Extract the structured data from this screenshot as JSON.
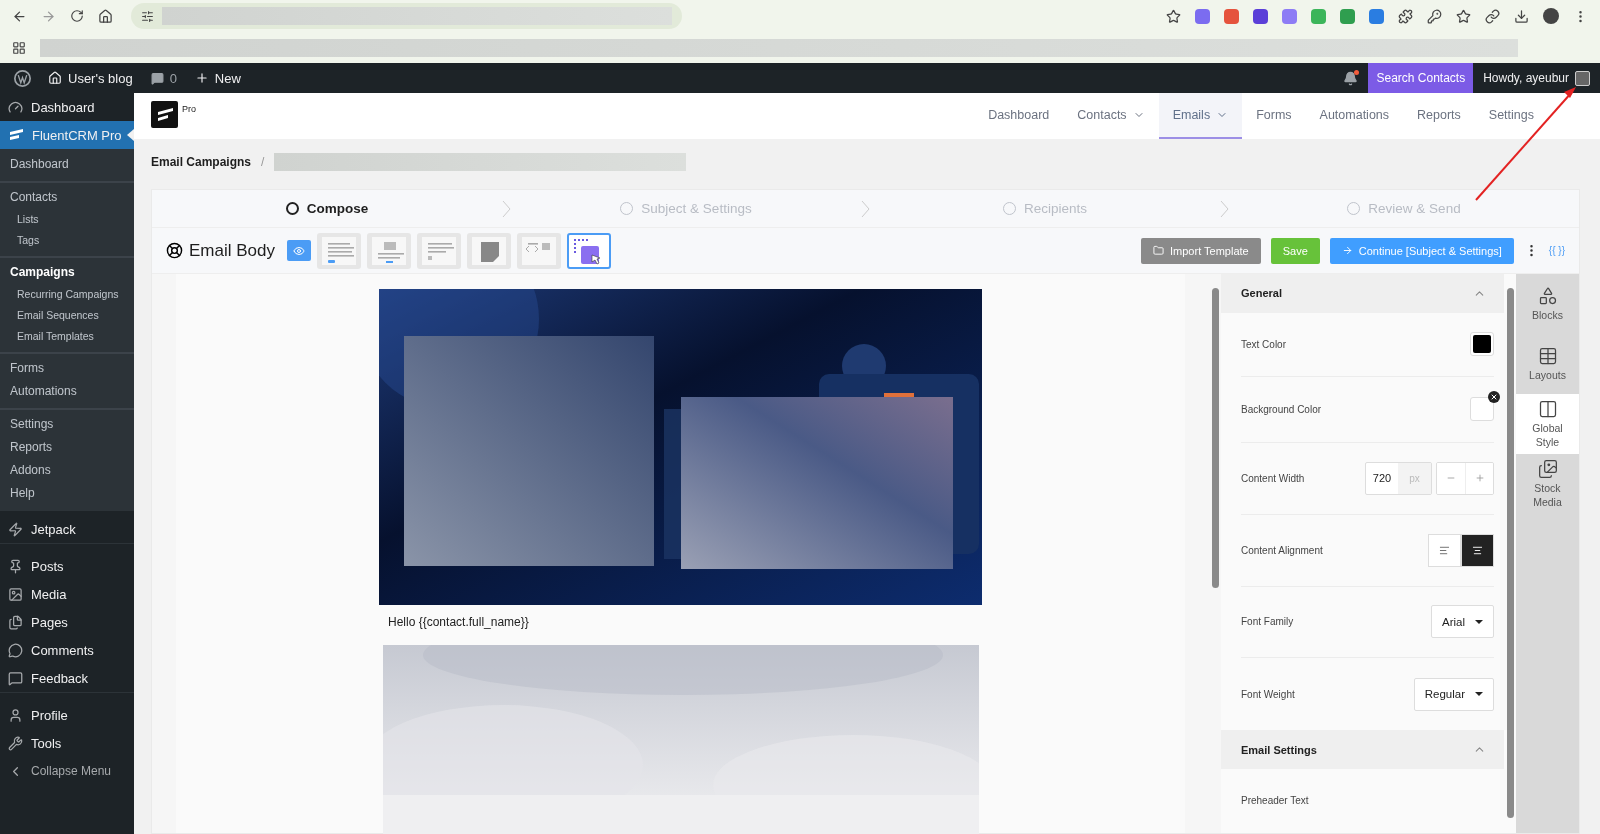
{
  "admin_bar": {
    "site": "User's blog",
    "comments": "0",
    "new": "New",
    "search_contacts": "Search Contacts",
    "greeting": "Howdy, ayeubur"
  },
  "sidebar": {
    "items": [
      {
        "label": "Dashboard",
        "kind": "menu",
        "selected": false
      },
      {
        "label": "FluentCRM Pro",
        "kind": "menu",
        "selected": true,
        "children": [
          {
            "label": "Dashboard",
            "selected": false
          },
          {
            "label": "Contacts",
            "selected": false,
            "group_start": true,
            "children": [
              {
                "label": "Lists",
                "selected": false
              },
              {
                "label": "Tags",
                "selected": false
              }
            ]
          },
          {
            "label": "Campaigns",
            "selected": true,
            "group_start": true,
            "children": [
              {
                "label": "Recurring Campaigns",
                "selected": false
              },
              {
                "label": "Email Sequences",
                "selected": false
              },
              {
                "label": "Email Templates",
                "selected": false
              }
            ]
          },
          {
            "label": "Forms",
            "selected": false,
            "group_start": true
          },
          {
            "label": "Automations",
            "selected": false
          },
          {
            "label": "Settings",
            "selected": false,
            "group_start": true
          },
          {
            "label": "Reports",
            "selected": false
          },
          {
            "label": "Addons",
            "selected": false
          },
          {
            "label": "Help",
            "selected": false
          }
        ]
      },
      {
        "label": "Jetpack",
        "kind": "menu",
        "selected": false
      },
      {
        "label": "Posts",
        "kind": "menu",
        "selected": false,
        "group_start": true
      },
      {
        "label": "Media",
        "kind": "menu",
        "selected": false
      },
      {
        "label": "Pages",
        "kind": "menu",
        "selected": false
      },
      {
        "label": "Comments",
        "kind": "menu",
        "selected": false
      },
      {
        "label": "Feedback",
        "kind": "menu",
        "selected": false
      },
      {
        "label": "Profile",
        "kind": "menu",
        "selected": false,
        "group_start": true
      },
      {
        "label": "Tools",
        "kind": "menu",
        "selected": false
      },
      {
        "label": "Collapse Menu",
        "kind": "collapse",
        "selected": false
      }
    ]
  },
  "header": {
    "logo_badge": "Pro",
    "nav": [
      {
        "label": "Dashboard",
        "dropdown": false,
        "selected": false
      },
      {
        "label": "Contacts",
        "dropdown": true,
        "selected": false
      },
      {
        "label": "Emails",
        "dropdown": true,
        "selected": true
      },
      {
        "label": "Forms",
        "dropdown": false,
        "selected": false
      },
      {
        "label": "Automations",
        "dropdown": false,
        "selected": false
      },
      {
        "label": "Reports",
        "dropdown": false,
        "selected": false
      },
      {
        "label": "Settings",
        "dropdown": false,
        "selected": false
      }
    ]
  },
  "breadcrumb": {
    "parent": "Email Campaigns",
    "separator": "/"
  },
  "steps": [
    {
      "label": "Compose",
      "selected": true
    },
    {
      "label": "Subject & Settings",
      "selected": false
    },
    {
      "label": "Recipients",
      "selected": false
    },
    {
      "label": "Review & Send",
      "selected": false
    }
  ],
  "toolbar": {
    "title": "Email Body",
    "templates": [
      {
        "kind": "plain",
        "selected": false
      },
      {
        "kind": "banner",
        "selected": false
      },
      {
        "kind": "simple",
        "selected": false
      },
      {
        "kind": "note",
        "selected": false
      },
      {
        "kind": "code",
        "selected": false
      },
      {
        "kind": "visual",
        "selected": true
      }
    ],
    "import_button": "Import Template",
    "save_button": "Save",
    "continue_button": "Continue [Subject & Settings]",
    "smartcode_button": "{{ }}"
  },
  "email": {
    "greeting": "Hello {{contact.full_name}}"
  },
  "settings": {
    "sections": [
      {
        "title": "General",
        "expanded": true,
        "rows": [
          {
            "kind": "color",
            "label": "Text Color",
            "color": "#000000",
            "clearable": false
          },
          {
            "kind": "color",
            "label": "Background Color",
            "clearable": true
          },
          {
            "kind": "number",
            "label": "Content Width",
            "value": "720",
            "unit": "px"
          },
          {
            "kind": "align",
            "label": "Content Alignment",
            "options": [
              {
                "selected": false
              },
              {
                "selected": true
              }
            ]
          },
          {
            "kind": "select",
            "label": "Font Family",
            "value": "Arial"
          },
          {
            "kind": "select",
            "label": "Font Weight",
            "value": "Regular"
          }
        ]
      },
      {
        "title": "Email Settings",
        "expanded": true,
        "rows": [
          {
            "kind": "text",
            "label": "Preheader Text"
          }
        ]
      }
    ]
  },
  "side_tabs": [
    {
      "label": "Blocks",
      "selected": false
    },
    {
      "label": "Layouts",
      "selected": false
    },
    {
      "label": "Global Style",
      "selected": true
    },
    {
      "label": "Stock Media",
      "selected": false
    }
  ]
}
